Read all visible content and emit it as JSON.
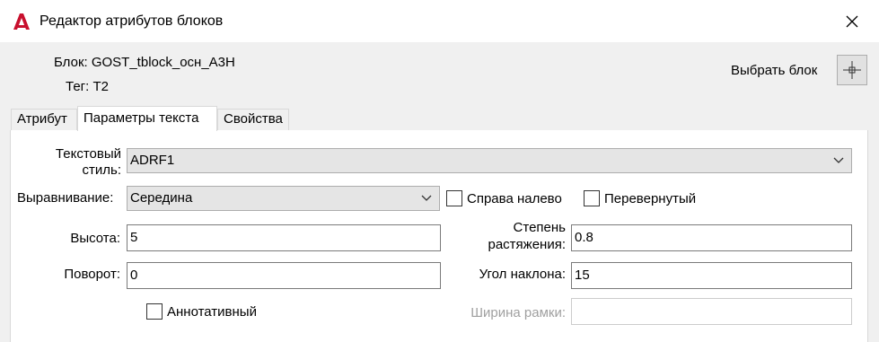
{
  "window": {
    "title": "Редактор атрибутов блоков"
  },
  "header": {
    "block_label": "Блок: GOST_tblock_осн_А3Н",
    "tag_label": "Тег: Т2",
    "pick_block_label": "Выбрать блок"
  },
  "tabs": [
    {
      "label": "Атрибут",
      "active": false
    },
    {
      "label": "Параметры текста",
      "active": true
    },
    {
      "label": "Свойства",
      "active": false
    }
  ],
  "form": {
    "text_style_label_line1": "Текстовый",
    "text_style_label_line2": "стиль:",
    "text_style_value": "ADRF1",
    "justification_label": "Выравнивание:",
    "justification_value": "Середина",
    "backwards_label": "Справа налево",
    "backwards_checked": false,
    "upside_down_label": "Перевернутый",
    "upside_down_checked": false,
    "height_label": "Высота:",
    "height_value": "5",
    "width_factor_label_line1": "Степень",
    "width_factor_label_line2": "растяжения:",
    "width_factor_value": "0.8",
    "rotation_label": "Поворот:",
    "rotation_value": "0",
    "oblique_label": "Угол наклона:",
    "oblique_value": "15",
    "annotative_label": "Аннотативный",
    "annotative_checked": false,
    "boundary_width_label": "Ширина рамки:",
    "boundary_width_value": ""
  },
  "colors": {
    "app_icon": "#c8102e"
  }
}
